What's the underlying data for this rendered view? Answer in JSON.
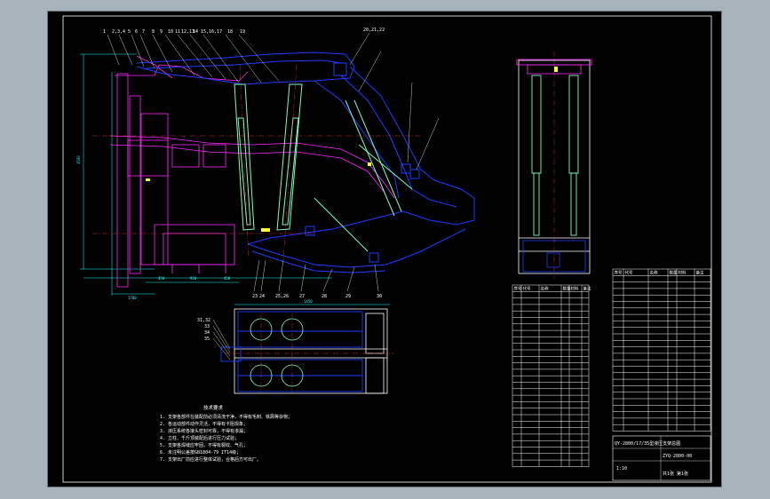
{
  "drawing": {
    "colors": {
      "background": "#000000",
      "frame": "#ffffff",
      "support_structure": "#1f3cff",
      "base_beam": "#ff2bff",
      "hydraulic_legs": "#7fffbf",
      "dimension_lines": "#22ffff",
      "centerlines": "#ff3b3b",
      "annotations": "#ffffff",
      "highlight": "#ffff33"
    },
    "title_block": {
      "project": "QY-2800/17/35型液压支架总图",
      "drawing_number": "ZYQ-2800-00",
      "scale": "1:10",
      "sheet": "共1张 第1张"
    },
    "tech_requirements": {
      "heading": "技术要求",
      "lines": [
        "1. 支架各部件在装配前必须清洗干净，不得有毛刺、铁屑等杂物；",
        "2. 各运动部件动作灵活，不得有卡阻现象；",
        "3. 液压系统各接头密封可靠，不得有渗漏；",
        "4. 立柱、千斤顶装配后进行压力试验；",
        "5. 支架各焊缝应牢固，不得有裂纹、气孔；",
        "6. 未注明公差按GB1804-79 IT14级；",
        "7. 支架出厂前应进行整体试验，合格后方可出厂。"
      ]
    },
    "parts_list_a": {
      "header": [
        "序号",
        "代号",
        "名称",
        "数量",
        "材料",
        "备注"
      ],
      "rows": 27
    },
    "parts_list_b": {
      "header": [
        "序号",
        "代号",
        "名称",
        "数量",
        "材料",
        "备注"
      ],
      "rows": 24
    },
    "balloon_labels_top": [
      "1",
      "2,3,4",
      "5",
      "6",
      "7",
      "8",
      "9",
      "10",
      "11",
      "12,13",
      "14",
      "15,16,17",
      "18",
      "19",
      "20,21,22"
    ],
    "balloon_labels_bottom": [
      "23",
      "24",
      "25,26",
      "27",
      "28",
      "29",
      "30"
    ],
    "balloon_labels_plan": [
      "31,32",
      "33",
      "34",
      "35"
    ],
    "dimension_labels": {
      "overall_height": "3500",
      "base_segments": [
        "450",
        "920",
        "450"
      ],
      "plan_width": "1450",
      "min_height": "1700"
    }
  }
}
